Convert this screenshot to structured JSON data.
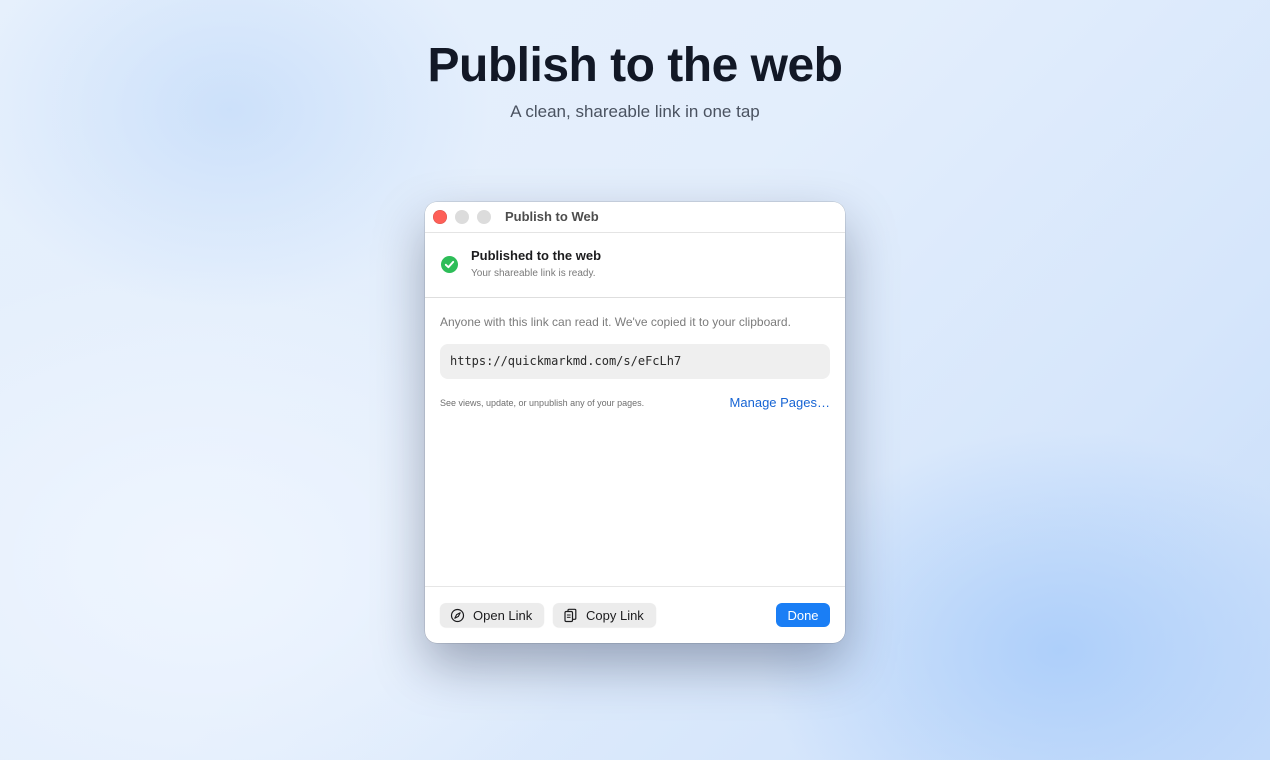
{
  "hero": {
    "title": "Publish to the web",
    "subtitle": "A clean, shareable link in one tap"
  },
  "window": {
    "title": "Publish to Web",
    "traffic_lights": [
      "close",
      "minimize",
      "zoom"
    ]
  },
  "status": {
    "icon": "checkmark-circle-icon",
    "title": "Published to the web",
    "subtitle": "Your shareable link is ready."
  },
  "body": {
    "info": "Anyone with this link can read it. We've copied it to your clipboard.",
    "url": "https://quickmarkmd.com/s/eFcLh7",
    "manage_hint": "See views, update, or unpublish any of your pages.",
    "manage_link": "Manage Pages…"
  },
  "footer": {
    "open_label": "Open Link",
    "open_icon": "compass-icon",
    "copy_label": "Copy Link",
    "copy_icon": "copy-icon",
    "done_label": "Done"
  },
  "colors": {
    "accent": "#1a7ef5",
    "link": "#1664d4",
    "success": "#2dbd58",
    "close_light": "#fe5f57"
  }
}
